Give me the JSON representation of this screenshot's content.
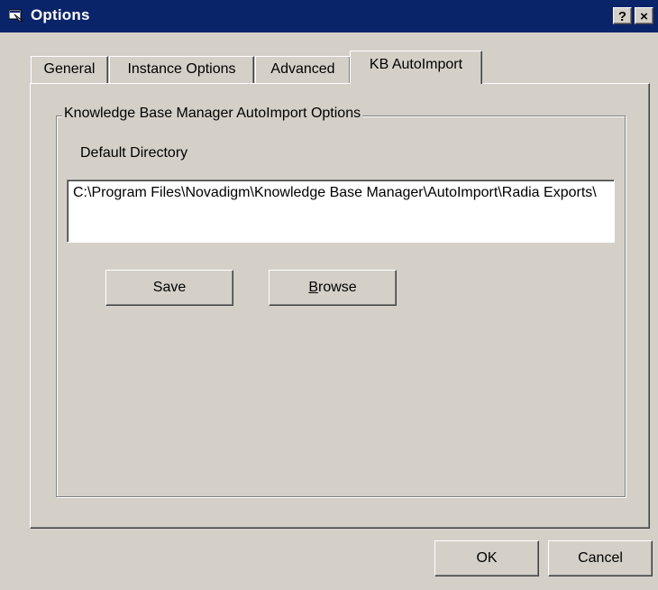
{
  "window": {
    "title": "Options",
    "help_label": "?",
    "close_label": "×"
  },
  "tabs": [
    {
      "label": "General"
    },
    {
      "label": "Instance Options"
    },
    {
      "label": "Advanced"
    },
    {
      "label": "KB AutoImport",
      "selected": true
    }
  ],
  "autoimport": {
    "group_title": "Knowledge Base Manager AutoImport Options",
    "default_dir_label": "Default Directory",
    "default_dir_value": "C:\\Program Files\\Novadigm\\Knowledge Base Manager\\AutoImport\\Radia Exports\\",
    "save_label": "Save",
    "browse_mnemonic": "B",
    "browse_rest": "rowse"
  },
  "footer": {
    "ok_label": "OK",
    "cancel_label": "Cancel"
  },
  "colors": {
    "titlebar": "#0a246a",
    "face": "#d4d0c8",
    "field": "#ffffff"
  },
  "icons": {
    "window_icon": "options-window-icon"
  }
}
